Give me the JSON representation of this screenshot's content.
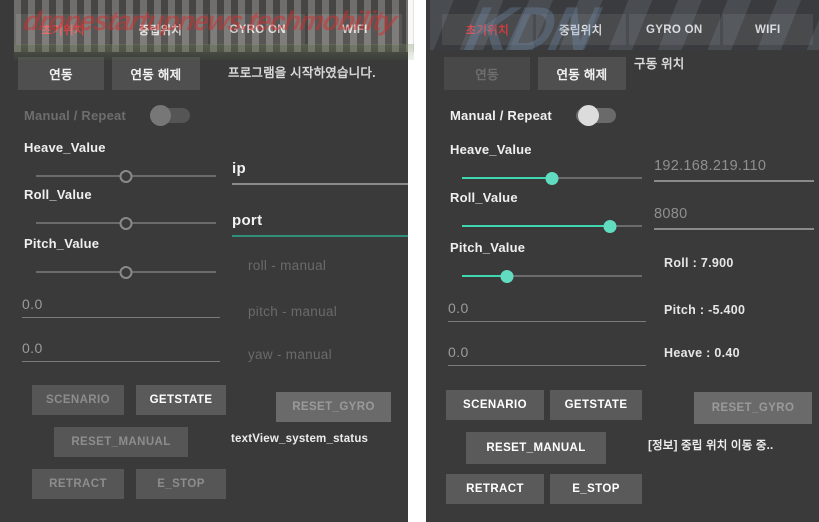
{
  "meta": {
    "watermark_left": "dronestartupnews.techmobility",
    "watermark_right": "KDN"
  },
  "colors": {
    "panel_bg": "#3a3a3a",
    "accent_teal": "#3fd6b0",
    "accent_red": "#e23b3b",
    "button_bg": "#5a5a5a",
    "text": "#f2f2f2"
  },
  "left_panel": {
    "tabs": [
      {
        "label": "초기위치",
        "accent": true
      },
      {
        "label": "중립위치",
        "accent": false
      },
      {
        "label": "GYRO ON",
        "accent": false
      },
      {
        "label": "WIFI",
        "accent": false
      }
    ],
    "link_buttons": [
      {
        "label": "연동",
        "enabled": true
      },
      {
        "label": "연동 해제",
        "enabled": true
      }
    ],
    "top_message": "프로그램을 시작하였습니다.",
    "manual_repeat_label": "Manual / Repeat",
    "manual_repeat_on": false,
    "sliders": [
      {
        "label": "Heave_Value",
        "percent": 50
      },
      {
        "label": "Roll_Value",
        "percent": 50
      },
      {
        "label": "Pitch_Value",
        "percent": 50
      }
    ],
    "number_fields": [
      {
        "value": "0.0"
      },
      {
        "value": "0.0"
      }
    ],
    "ip_field": {
      "placeholder": "ip",
      "value": "",
      "focused": false
    },
    "port_field": {
      "placeholder": "port",
      "value": "",
      "focused": true
    },
    "manual_labels": [
      "roll - manual",
      "pitch - manual",
      "yaw - manual"
    ],
    "action_buttons": [
      {
        "label": "SCENARIO",
        "enabled": false
      },
      {
        "label": "GETSTATE",
        "enabled": true
      },
      {
        "label": "RESET_GYRO",
        "enabled": false
      },
      {
        "label": "RESET_MANUAL",
        "enabled": false
      },
      {
        "label": "RETRACT",
        "enabled": false
      },
      {
        "label": "E_STOP",
        "enabled": false
      }
    ],
    "status_text": "textView_system_status"
  },
  "right_panel": {
    "tabs": [
      {
        "label": "초기위치",
        "accent": true
      },
      {
        "label": "중립위치",
        "accent": false
      },
      {
        "label": "GYRO ON",
        "accent": false
      },
      {
        "label": "WIFI",
        "accent": false
      }
    ],
    "link_buttons": [
      {
        "label": "연동",
        "enabled": false
      },
      {
        "label": "연동 해제",
        "enabled": true
      }
    ],
    "top_message": "구동 위치",
    "manual_repeat_label": "Manual / Repeat",
    "manual_repeat_on": true,
    "sliders": [
      {
        "label": "Heave_Value",
        "percent": 50
      },
      {
        "label": "Roll_Value",
        "percent": 82
      },
      {
        "label": "Pitch_Value",
        "percent": 25
      }
    ],
    "number_fields": [
      {
        "value": "0.0"
      },
      {
        "value": "0.0"
      }
    ],
    "ip_field": {
      "placeholder": "ip",
      "value": "192.168.219.110",
      "focused": false
    },
    "port_field": {
      "placeholder": "port",
      "value": "8080",
      "focused": false
    },
    "readouts": [
      "Roll : 7.900",
      "Pitch : -5.400",
      "Heave : 0.40"
    ],
    "action_buttons": [
      {
        "label": "SCENARIO",
        "enabled": true
      },
      {
        "label": "GETSTATE",
        "enabled": true
      },
      {
        "label": "RESET_GYRO",
        "enabled": false
      },
      {
        "label": "RESET_MANUAL",
        "enabled": true
      },
      {
        "label": "RETRACT",
        "enabled": true
      },
      {
        "label": "E_STOP",
        "enabled": true
      }
    ],
    "status_text": "[정보] 중립 위치 이동 중.."
  }
}
